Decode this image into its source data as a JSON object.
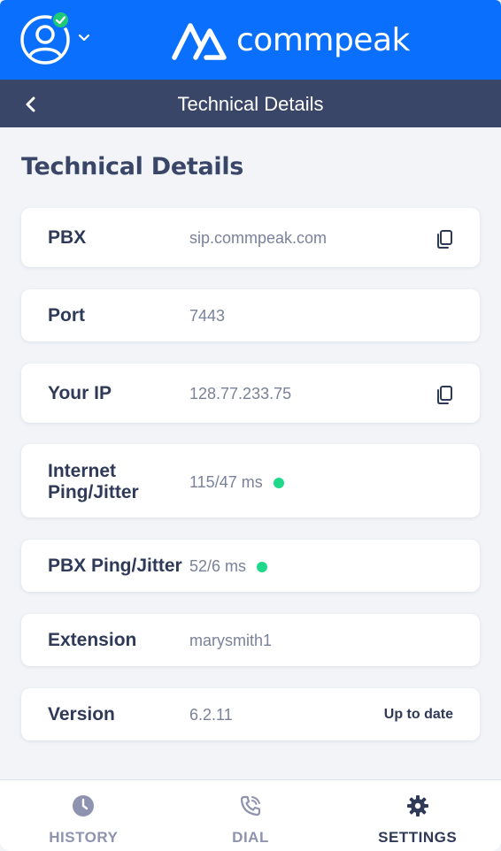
{
  "colors": {
    "brand_blue": "#0a6ffd",
    "subheader": "#3a4667",
    "status_green": "#1ec978",
    "text_dark": "#2f3a58",
    "text_muted": "#7a829a",
    "nav_inactive": "#8e93b0"
  },
  "header": {
    "brand_name": "commpeak",
    "avatar_icon": "user-circle-icon",
    "status": "online"
  },
  "subheader": {
    "title": "Technical Details",
    "back_icon": "chevron-left-icon"
  },
  "page": {
    "title": "Technical Details"
  },
  "details": [
    {
      "label": "PBX",
      "value": "sip.commpeak.com",
      "copyable": true
    },
    {
      "label": "Port",
      "value": "7443"
    },
    {
      "label": "Your IP",
      "value": "128.77.233.75",
      "copyable": true
    },
    {
      "label_line1": "Internet",
      "label_line2": "Ping/Jitter",
      "value": "115/47 ms",
      "indicator": "green"
    },
    {
      "label": "PBX Ping/Jitter",
      "value": "52/6 ms",
      "indicator": "green"
    },
    {
      "label": "Extension",
      "value": "marysmith1"
    },
    {
      "label": "Version",
      "value": "6.2.11",
      "status": "Up to date"
    }
  ],
  "nav": [
    {
      "label": "HISTORY",
      "icon": "clock-icon",
      "active": false
    },
    {
      "label": "DIAL",
      "icon": "phone-icon",
      "active": false
    },
    {
      "label": "SETTINGS",
      "icon": "gear-icon",
      "active": true
    }
  ]
}
